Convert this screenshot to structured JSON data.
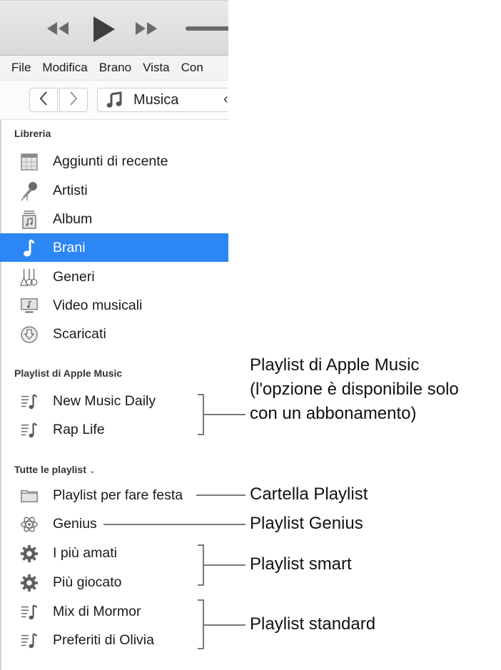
{
  "player": {
    "rewind_icon": "rewind-icon",
    "play_icon": "play-icon",
    "fast_forward_icon": "fast-forward-icon",
    "volume": "volume-slider"
  },
  "menubar": {
    "items": [
      "File",
      "Modifica",
      "Brano",
      "Vista",
      "Con"
    ]
  },
  "navbar": {
    "back_icon": "chevron-left-icon",
    "forward_icon": "chevron-right-icon",
    "media_icon": "music-note-icon",
    "media_label": "Musica",
    "media_caret": "‹"
  },
  "sidebar": {
    "library": {
      "header": "Libreria",
      "items": [
        {
          "label": "Aggiunti di recente",
          "icon": "calendar-grid-icon"
        },
        {
          "label": "Artisti",
          "icon": "microphone-icon"
        },
        {
          "label": "Album",
          "icon": "album-stack-icon"
        },
        {
          "label": "Brani",
          "icon": "music-note-icon",
          "selected": true
        },
        {
          "label": "Generi",
          "icon": "guitars-icon"
        },
        {
          "label": "Video musicali",
          "icon": "music-video-icon"
        },
        {
          "label": "Scaricati",
          "icon": "download-circle-icon"
        }
      ]
    },
    "apple_music": {
      "header": "Playlist di Apple Music",
      "items": [
        {
          "label": "New Music Daily",
          "icon": "playlist-icon"
        },
        {
          "label": "Rap Life",
          "icon": "playlist-icon"
        }
      ]
    },
    "all_playlists": {
      "header": "Tutte le playlist",
      "header_chevron": "⌄",
      "items": [
        {
          "label": "Playlist per fare festa",
          "icon": "folder-icon"
        },
        {
          "label": "Genius",
          "icon": "genius-atom-icon"
        },
        {
          "label": "I più amati",
          "icon": "smart-gear-icon"
        },
        {
          "label": "Più giocato",
          "icon": "smart-gear-icon"
        },
        {
          "label": "Mix di Mormor",
          "icon": "playlist-icon"
        },
        {
          "label": "Preferiti di Olivia",
          "icon": "playlist-icon"
        }
      ]
    }
  },
  "callouts": {
    "apple_music_line1": "Playlist di Apple Music",
    "apple_music_line2": "(l'opzione è disponibile solo",
    "apple_music_line3": "con un abbonamento)",
    "folder": "Cartella Playlist",
    "genius": "Playlist Genius",
    "smart": "Playlist smart",
    "standard": "Playlist standard"
  },
  "colors": {
    "selection": "#2c86f3",
    "callout_line": "#7a7a7a"
  }
}
